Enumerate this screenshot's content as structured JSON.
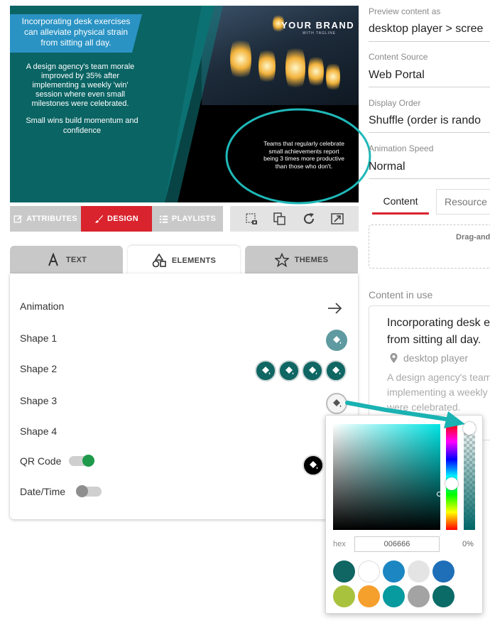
{
  "preview": {
    "brand": "YOUR BRAND",
    "brand_tagline": "WITH TAGLINE",
    "headline": "Incorporating desk exercises can alleviate physical strain from sitting all day.",
    "body1": "A design agency's team morale improved by 35% after implementing a weekly 'win' session where even small milestones were celebrated.",
    "body2": "Small wins build momentum and confidence",
    "stat": "Teams that regularly celebrate small achievements report being 3 times more productive than those who don't."
  },
  "toolbar": {
    "attributes": "ATTRIBUTES",
    "design": "DESIGN",
    "playlists": "PLAYLISTS",
    "tool_icons": [
      "crop-capture-icon",
      "layers-copy-icon",
      "refresh-icon",
      "fullscreen-icon"
    ]
  },
  "tabs": {
    "text": "TEXT",
    "elements": "ELEMENTS",
    "themes": "THEMES"
  },
  "elements": {
    "animation": "Animation",
    "shape1": "Shape 1",
    "shape2": "Shape 2",
    "shape3": "Shape 3",
    "shape4": "Shape 4",
    "qr_code": "QR Code",
    "date_time": "Date/Time",
    "qr_enabled": true,
    "datetime_enabled": false
  },
  "right": {
    "preview_as_label": "Preview content as",
    "preview_as_value": "desktop player > scree",
    "source_label": "Content Source",
    "source_value": "Web Portal",
    "order_label": "Display Order",
    "order_value": "Shuffle (order is rando",
    "speed_label": "Animation Speed",
    "speed_value": "Normal",
    "tab_content": "Content",
    "tab_resources": "Resource",
    "dropzone": "Drag-and",
    "in_use_label": "Content in use",
    "card_title": "Incorporating desk e from sitting all day.",
    "card_player": "desktop player",
    "card_excerpt": "A design agency's team implementing a weekly were celebrated."
  },
  "picker": {
    "hex_label": "hex",
    "hex_value": "006666",
    "opacity_value": "0%",
    "swatches": [
      "#0f6663",
      "#ffffff",
      "#1b86c2",
      "#e4e4e4",
      "#1f6fb8",
      "#a9c23e",
      "#f59f2d",
      "#079a9f",
      "#a3a3a3",
      "#0b6b66"
    ]
  },
  "colors": {
    "brand_teal": "#006666",
    "design_red": "#d9232d",
    "tab_inactive": "#c8c8c8",
    "accent_cyan": "#1fb8b8",
    "content_tab_underline": "#d9232d"
  }
}
